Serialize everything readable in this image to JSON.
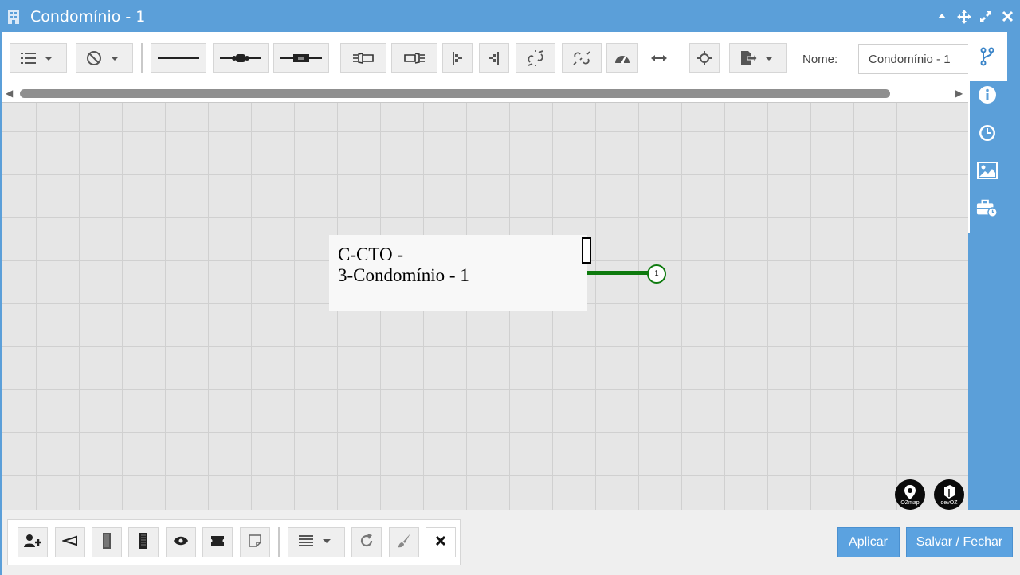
{
  "window": {
    "title": "Condomínio - 1",
    "controls": [
      "chevron-up-icon",
      "move-icon",
      "expand-icon",
      "close-icon"
    ]
  },
  "toolbar": {
    "buttons": [
      "list-menu-icon",
      "block-menu-icon",
      "cable-line-icon",
      "splice-closure-icon",
      "splice-box-icon",
      "connector-in-icon",
      "connector-out-icon",
      "align-left-icon",
      "align-right-icon",
      "unlink-icon",
      "link-break-icon",
      "dashboard-icon",
      "resize-horizontal-icon",
      "crosshair-icon",
      "export-icon"
    ],
    "name_label": "Nome:",
    "name_value": "Condomínio - 1"
  },
  "canvas": {
    "node": {
      "line1": "C-CTO -",
      "line2": "3-Condomínio - 1"
    },
    "fiber": {
      "number": "1",
      "color": "#0e7a0e"
    },
    "logos": [
      {
        "name": "ozmap-logo",
        "text": "OZmap"
      },
      {
        "name": "devoz-logo",
        "text": "devOZ"
      }
    ]
  },
  "sidebar": {
    "items": [
      "branch-icon",
      "info-icon",
      "clock-icon",
      "image-icon",
      "toolbox-clock-icon"
    ],
    "active": "branch-icon"
  },
  "bottom_toolbar": {
    "buttons": [
      "add-user-icon",
      "pointer-icon",
      "panel-icon",
      "panel-dark-icon",
      "eye-icon",
      "ticket-icon",
      "note-icon",
      "align-menu-icon",
      "refresh-icon",
      "brush-icon",
      "delete-icon"
    ]
  },
  "actions": {
    "apply_label": "Aplicar",
    "save_close_label": "Salvar / Fechar"
  },
  "colors": {
    "accent": "#5b9fd9",
    "button_primary": "#5ba2e0",
    "fiber_green": "#0e7a0e"
  }
}
